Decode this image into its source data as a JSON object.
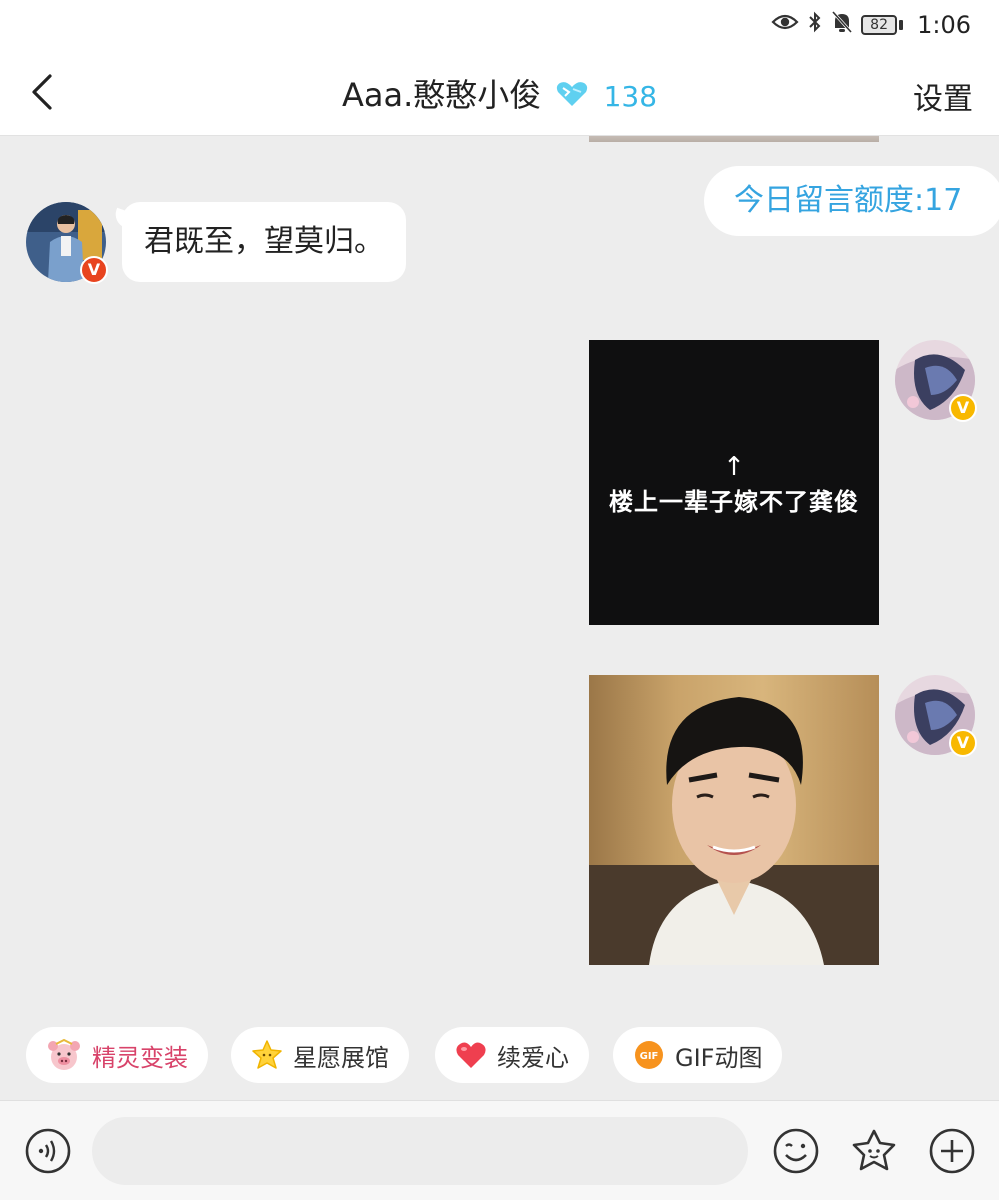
{
  "status_bar": {
    "battery_level": "82",
    "time": "1:06",
    "icons": [
      "eye-icon",
      "bluetooth-icon",
      "mute-bell-icon",
      "battery-icon"
    ]
  },
  "header": {
    "title": "Aaa.憨憨小俊",
    "badge_icon": "diamond-heart-badge-icon",
    "count": "138",
    "settings_label": "设置"
  },
  "chat": {
    "quota_text": "今日留言额度:17",
    "messages": [
      {
        "side": "left",
        "type": "text",
        "text": "君既至，望莫归。"
      },
      {
        "side": "right",
        "type": "image",
        "arrow": "↑",
        "caption": "楼上一辈子嫁不了龚俊"
      },
      {
        "side": "right",
        "type": "image",
        "content": "photo"
      }
    ]
  },
  "quick_actions": [
    {
      "label": "精灵变装",
      "icon": "pig-sprite-icon",
      "color": "#d8436a"
    },
    {
      "label": "星愿展馆",
      "icon": "star-icon"
    },
    {
      "label": "续爱心",
      "icon": "heart-icon"
    },
    {
      "label": "GIF动图",
      "icon": "gif-icon"
    }
  ],
  "input_bar": {
    "placeholder": "",
    "icons": [
      "voice-icon",
      "emoji-icon",
      "sticker-icon",
      "plus-icon"
    ]
  },
  "colors": {
    "accent_blue": "#35a4e0",
    "badge_gold": "#f8b800",
    "background": "#ededed"
  }
}
